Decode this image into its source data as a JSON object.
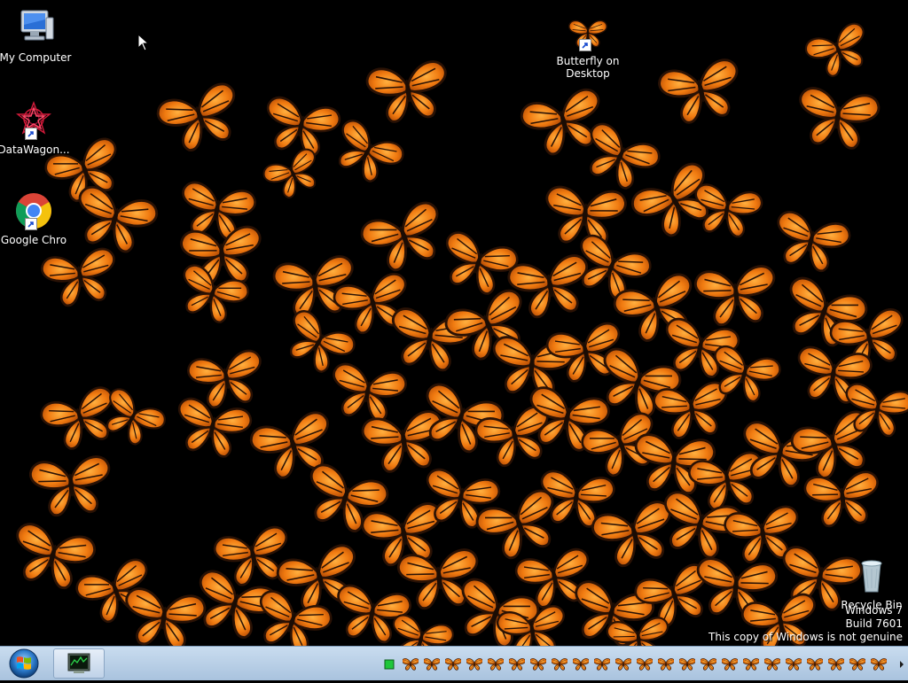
{
  "desktop": {
    "icons": [
      {
        "label": "My Computer",
        "icon": "computer-icon"
      },
      {
        "label": "DataWagon...",
        "icon": "datawagon-icon"
      },
      {
        "label": "Google Chro",
        "icon": "chrome-icon"
      },
      {
        "label": "Butterfly on Desktop",
        "icon": "butterfly-icon"
      },
      {
        "label": "Recycle Bin",
        "icon": "recycle-bin-icon"
      }
    ],
    "watermark": {
      "line1": "Windows 7",
      "line2": "Build 7601",
      "line3": "This copy of Windows is not genuine"
    }
  },
  "taskbar": {
    "start_icon": "windows-start-icon",
    "task_button_icon": "system-monitor-icon",
    "tray_icons": [
      "green-status-icon",
      "butterfly-icon",
      "butterfly-icon",
      "butterfly-icon",
      "butterfly-icon",
      "butterfly-icon",
      "butterfly-icon",
      "butterfly-icon",
      "butterfly-icon",
      "butterfly-icon",
      "butterfly-icon",
      "butterfly-icon",
      "butterfly-icon",
      "butterfly-icon",
      "butterfly-icon",
      "butterfly-icon",
      "butterfly-icon",
      "butterfly-icon",
      "butterfly-icon",
      "butterfly-icon",
      "butterfly-icon",
      "butterfly-icon",
      "butterfly-icon",
      "butterfly-icon"
    ],
    "overflow_icon": "chevron-right-icon"
  },
  "colors": {
    "wing_orange": "#f07a10",
    "wing_dark": "#2a1205",
    "taskbar_top": "#c9dcef",
    "taskbar_bottom": "#a9c3de"
  }
}
